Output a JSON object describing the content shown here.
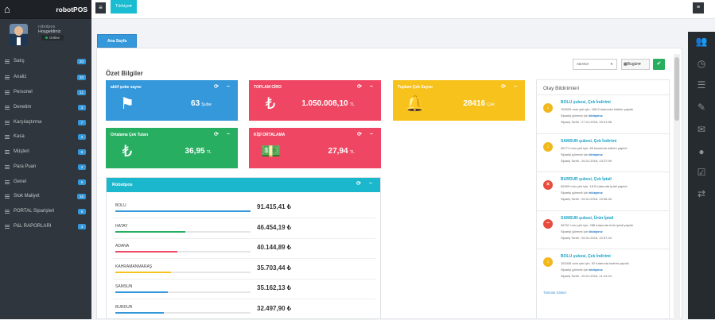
{
  "app": {
    "brand": "robotPOS"
  },
  "profile": {
    "name": "robotpos",
    "welcome": "Hoşgeldiniz",
    "status": "Online"
  },
  "sidebar": {
    "items": [
      {
        "label": "Satış",
        "badge": "20"
      },
      {
        "label": "Analiz",
        "badge": "20"
      },
      {
        "label": "Personel",
        "badge": "11"
      },
      {
        "label": "Denetim",
        "badge": "3"
      },
      {
        "label": "Karşılaştırma",
        "badge": "7"
      },
      {
        "label": "Kasa",
        "badge": "3"
      },
      {
        "label": "Müşteri",
        "badge": "8"
      },
      {
        "label": "Para Puan",
        "badge": "3"
      },
      {
        "label": "Genel",
        "badge": "6"
      },
      {
        "label": "Stok Maliyet",
        "badge": "16"
      },
      {
        "label": "PORTAL Siparişleri",
        "badge": "6"
      },
      {
        "label": "P&L RAPORLARI",
        "badge": "3"
      }
    ]
  },
  "topbar": {
    "language": "Türkiye▾"
  },
  "tabs": [
    {
      "label": "Ana Sayfa"
    }
  ],
  "filters": {
    "branch": "ADANA",
    "date": "Bugün▾"
  },
  "summary": {
    "title": "Özet Bilgiler"
  },
  "stats": [
    {
      "title": "aktif şube sayısı",
      "value": "63",
      "unit": "Şube",
      "color": "#3498db",
      "icon": "flag-icon"
    },
    {
      "title": "TOPLAM CİRO",
      "value": "1.050.008,10",
      "unit": "TL",
      "color": "#ef4763",
      "icon": "lira-icon"
    },
    {
      "title": "Toplam Çek Sayısı",
      "value": "28416",
      "unit": "Çek",
      "color": "#f7c21c",
      "icon": "bell-icon"
    },
    {
      "title": "Ortalama Çek Tutarı",
      "value": "36,95",
      "unit": "TL",
      "color": "#27ae60",
      "icon": "lira-icon"
    },
    {
      "title": "KİŞİ ORTALAMA",
      "value": "27,94",
      "unit": "TL",
      "color": "#ef4763",
      "icon": "money-icon"
    }
  ],
  "robotpos": {
    "title": "Robotpos",
    "rows": [
      {
        "name": "BOLU",
        "value": "91.415,41 ₺",
        "share": 1.0,
        "color": "#3498db"
      },
      {
        "name": "HATAY",
        "value": "46.454,19 ₺",
        "share": 0.52,
        "color": "#27ae60"
      },
      {
        "name": "ADANA",
        "value": "40.144,89 ₺",
        "share": 0.46,
        "color": "#ef4763"
      },
      {
        "name": "KAHRAMANMARAŞ",
        "value": "35.703,44 ₺",
        "share": 0.41,
        "color": "#f7c21c"
      },
      {
        "name": "SAMSUN",
        "value": "35.162,13 ₺",
        "share": 0.39,
        "color": "#3498db"
      },
      {
        "name": "BURDUR",
        "value": "32.497,90 ₺",
        "share": 0.36,
        "color": "#3498db"
      }
    ]
  },
  "events": {
    "title": "Olay Bildirimleri",
    "more": "Tümünü Göster",
    "items": [
      {
        "title": "BOLU şubesi, Çek İndirimi",
        "line1": "152526 nolu çek için, 156.5 tutarında indirim yapıldı",
        "line2a": "Siparişi görmek için ",
        "link": "tıklayınız",
        "line3": "Sipariş Tarihi : 27.01.2016, 00:01:58",
        "type": "warn"
      },
      {
        "title": "SAMSUN şubesi, Çek İndirimi",
        "line1": "36771 nolu çek için, 89 tutarında indirim yapıldı",
        "line2a": "Siparişi görmek için ",
        "link": "tıklayınız",
        "line3": "Sipariş Tarihi : 26.01.2016, 23:27:59",
        "type": "warn"
      },
      {
        "title": "BURDUR şubesi, Çek İptali",
        "line1": "89459 nolu çek için, 18.5 tutarında İptali yapıldı",
        "line2a": "Siparişi görmek için ",
        "link": "tıklayınız",
        "line3": "Sipariş Tarihi : 26.01.2016, 23:06:40",
        "type": "cancel"
      },
      {
        "title": "SAMSUN şubesi, Ürün İptali",
        "line1": "36767 nolu çek için, 288 tutarında ürün iptali yapıldı",
        "line2a": "Siparişi görmek için ",
        "link": "tıklayınız",
        "line3": "Sipariş Tarihi : 26.01.2016, 22:57:34",
        "type": "remove"
      },
      {
        "title": "BOLU şubesi, Çek İndirimi",
        "line1": "152436 nolu çek için, 92 tutarında indirim yapıldı",
        "line2a": "Siparişi görmek için ",
        "link": "tıklayınız",
        "line3": "Sipariş Tarihi : 26.01.2016, 21:41:04",
        "type": "warn"
      }
    ]
  }
}
